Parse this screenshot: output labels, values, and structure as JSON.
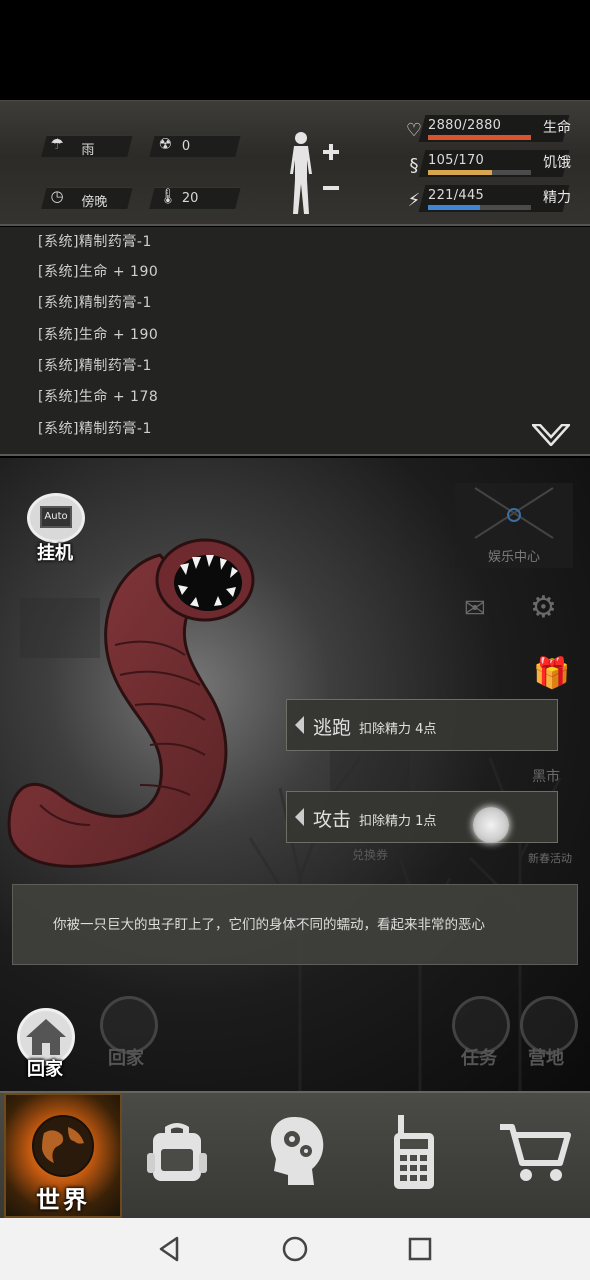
{
  "status": {
    "weather": "雨",
    "radiation": "0",
    "time_of_day": "傍晚",
    "temperature": "20",
    "stats": [
      {
        "icon": "heart-icon",
        "text": "2880/2880",
        "label": "生命",
        "fraction": 1.0,
        "color": "#d9542d"
      },
      {
        "icon": "stomach-icon",
        "text": "105/170",
        "label": "饥饿",
        "fraction": 0.62,
        "color": "#d7a650"
      },
      {
        "icon": "lightning-icon",
        "text": "221/445",
        "label": "精力",
        "fraction": 0.5,
        "color": "#3f86d6"
      }
    ]
  },
  "log": {
    "lines": [
      "[系统]精制药膏-1",
      "[系统]生命 + 190",
      "[系统]精制药膏-1",
      "[系统]生命 + 190",
      "[系统]精制药膏-1",
      "[系统]生命 + 178",
      "[系统]精制药膏-1"
    ]
  },
  "scene": {
    "auto_label": "挂机",
    "auto_icon_text": "Auto",
    "entertainment_label": "娱乐中心",
    "black_market_label": "黑市",
    "new_year_label": "新春活动",
    "exchange_label": "兑换券",
    "actions": [
      {
        "title": "逃跑",
        "cost": "扣除精力 4点"
      },
      {
        "title": "攻击",
        "cost": "扣除精力 1点"
      }
    ],
    "message": "你被一只巨大的虫子盯上了，它们的身体不同的蠕动，看起来非常的恶心",
    "home_label": "回家",
    "ghost_home_label": "回家",
    "task_label": "任务",
    "camp_label": "营地"
  },
  "tabs": [
    {
      "label": "世界",
      "icon": "globe-icon"
    },
    {
      "label": "",
      "icon": "backpack-icon"
    },
    {
      "label": "",
      "icon": "head-gears-icon"
    },
    {
      "label": "",
      "icon": "walkie-talkie-icon"
    },
    {
      "label": "",
      "icon": "cart-icon"
    }
  ],
  "colors": {
    "accent": "#e8892d",
    "panel": "#2c2b28"
  }
}
